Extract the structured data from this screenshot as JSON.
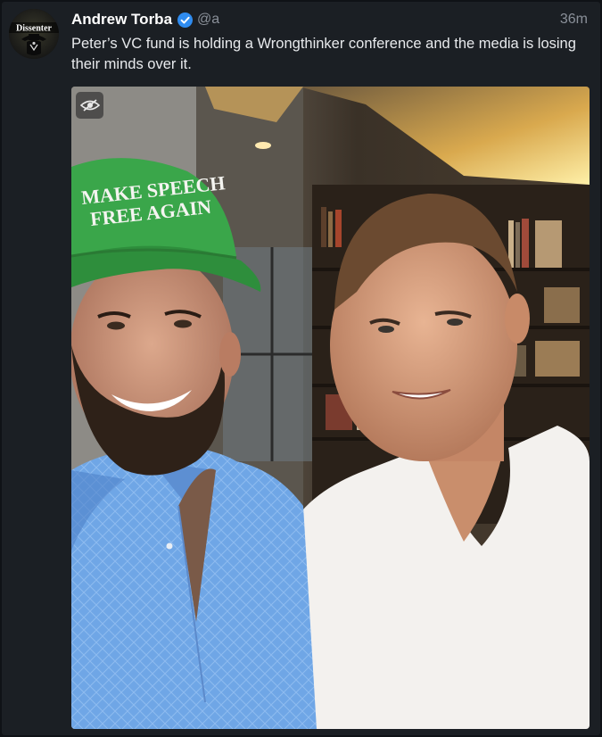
{
  "post": {
    "author": {
      "display_name": "Andrew Torba",
      "handle": "@a",
      "verified": true,
      "avatar_label": "Dissenter",
      "avatar_icon": "dissenter-logo-icon"
    },
    "timestamp": "36m",
    "text": "Peter’s VC fund is holding a Wrongthinker conference and the media is losing their minds over it.",
    "media": {
      "kind": "photo",
      "hat_text": "MAKE SPEECH FREE AGAIN",
      "toggle_icon": "eye-slash-icon"
    }
  },
  "colors": {
    "background": "#0f1216",
    "card": "#1b1f24",
    "verified": "#2f8cf0",
    "muted_text": "#8a9099"
  }
}
